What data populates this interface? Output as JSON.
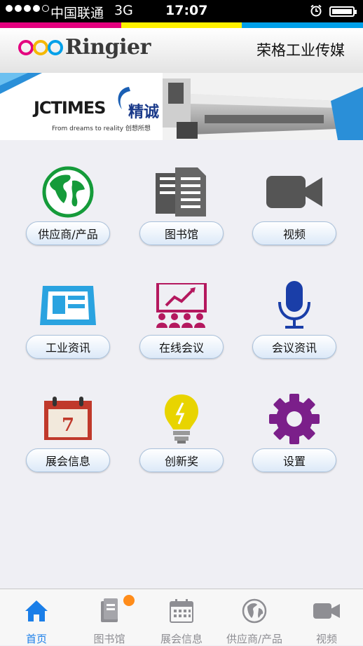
{
  "status_bar": {
    "carrier": "中国联通",
    "network": "3G",
    "time": "17:07",
    "signal_bars_filled": 4,
    "signal_bars_total": 5
  },
  "header": {
    "brand": "Ringier",
    "company": "荣格工业传媒"
  },
  "colors": {
    "strip": [
      "#e4007f",
      "#fff100",
      "#00a0e9"
    ],
    "accent": "#1a7ee8",
    "badge": "#ff8c1a"
  },
  "banner": {
    "brand": "JCTIMES",
    "brand_cn": "精诚",
    "slogan": "From dreams to reality 创想所想"
  },
  "menu": [
    {
      "label": "供应商/产品",
      "icon": "globe-icon"
    },
    {
      "label": "图书馆",
      "icon": "documents-icon"
    },
    {
      "label": "视频",
      "icon": "video-camera-icon"
    },
    {
      "label": "工业资讯",
      "icon": "newspaper-icon"
    },
    {
      "label": "在线会议",
      "icon": "presentation-icon"
    },
    {
      "label": "会议资讯",
      "icon": "microphone-icon"
    },
    {
      "label": "展会信息",
      "icon": "calendar-icon"
    },
    {
      "label": "创新奖",
      "icon": "lightbulb-icon"
    },
    {
      "label": "设置",
      "icon": "gear-icon"
    }
  ],
  "calendar_day": "7",
  "tabs": [
    {
      "label": "首页",
      "icon": "home-icon",
      "active": true
    },
    {
      "label": "图书馆",
      "icon": "book-icon",
      "badge": true
    },
    {
      "label": "展会信息",
      "icon": "calendar-icon"
    },
    {
      "label": "供应商/产品",
      "icon": "globe-icon"
    },
    {
      "label": "视频",
      "icon": "video-camera-icon"
    }
  ]
}
